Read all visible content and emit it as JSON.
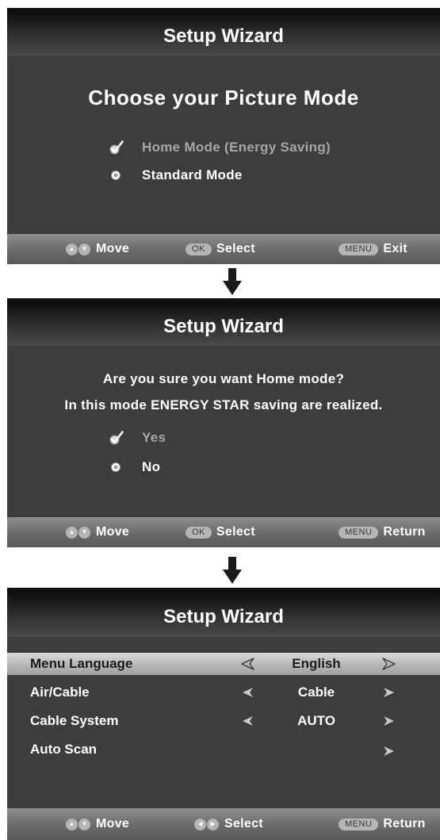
{
  "screen1": {
    "title": "Setup Wizard",
    "heading": "Choose your Picture Mode",
    "options": [
      {
        "label": "Home Mode (Energy Saving)",
        "selected": true
      },
      {
        "label": "Standard Mode",
        "selected": false
      }
    ],
    "footer": {
      "move": "Move",
      "ok_key": "OK",
      "select": "Select",
      "menu_key": "MENU",
      "action": "Exit"
    }
  },
  "screen2": {
    "title": "Setup Wizard",
    "question_line1": "Are you sure you want Home mode?",
    "question_line2": "In this mode ENERGY STAR saving are realized.",
    "options": [
      {
        "label": "Yes",
        "selected": true
      },
      {
        "label": "No",
        "selected": false
      }
    ],
    "footer": {
      "move": "Move",
      "ok_key": "OK",
      "select": "Select",
      "menu_key": "MENU",
      "action": "Return"
    }
  },
  "screen3": {
    "title": "Setup Wizard",
    "rows": [
      {
        "label": "Menu Language",
        "value": "English",
        "highlighted": true
      },
      {
        "label": "Air/Cable",
        "value": "Cable",
        "highlighted": false
      },
      {
        "label": "Cable System",
        "value": "AUTO",
        "highlighted": false
      },
      {
        "label": "Auto Scan",
        "value": "",
        "highlighted": false
      }
    ],
    "footer": {
      "move": "Move",
      "select": "Select",
      "menu_key": "MENU",
      "action": "Return"
    }
  },
  "icons": {
    "check": "checkmark-icon",
    "radio": "radio-icon",
    "arrow": "arrow-down-icon",
    "nav": "up-down-icon",
    "chevron_left": "chevron-left-icon",
    "chevron_right": "chevron-right-icon"
  },
  "colors": {
    "panel_bg": "#3d3d3d",
    "highlight_row": "#c0c0c0",
    "selected_text": "#a6a6a6",
    "text": "#ffffff"
  }
}
